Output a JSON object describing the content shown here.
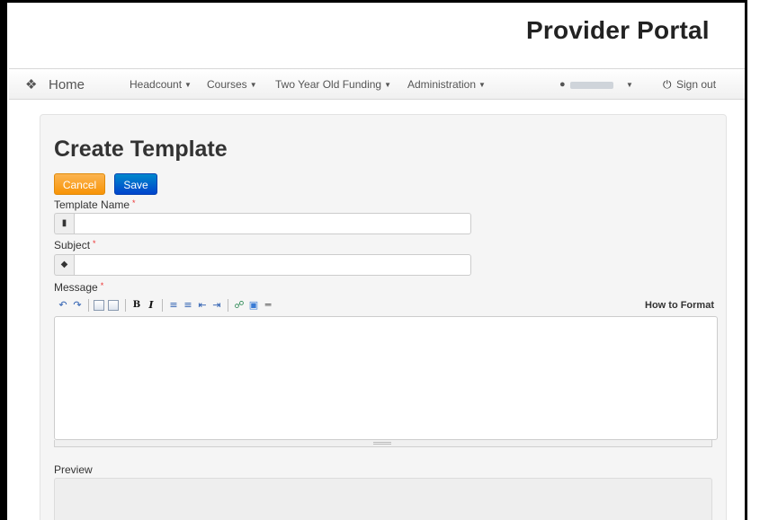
{
  "app": {
    "title": "Provider Portal"
  },
  "nav": {
    "home": "Home",
    "items": [
      {
        "label": "Headcount"
      },
      {
        "label": "Courses"
      },
      {
        "label": "Two Year Old Funding"
      },
      {
        "label": "Administration"
      }
    ],
    "sign_out": "Sign out"
  },
  "page": {
    "title": "Create Template"
  },
  "buttons": {
    "cancel": "Cancel",
    "save": "Save"
  },
  "form": {
    "template_name": {
      "label": "Template Name",
      "required_mark": "*",
      "value": ""
    },
    "subject": {
      "label": "Subject",
      "required_mark": "*",
      "value": ""
    },
    "message": {
      "label": "Message",
      "required_mark": "*",
      "value": ""
    }
  },
  "editor": {
    "how_to_format": "How to Format",
    "toolbar": [
      "undo-icon",
      "redo-icon",
      "source-icon",
      "preview-icon",
      "bold-icon",
      "italic-icon",
      "bullet-list-icon",
      "numbered-list-icon",
      "outdent-icon",
      "indent-icon",
      "link-icon",
      "image-icon",
      "horizontal-rule-icon"
    ]
  },
  "preview": {
    "label": "Preview"
  }
}
